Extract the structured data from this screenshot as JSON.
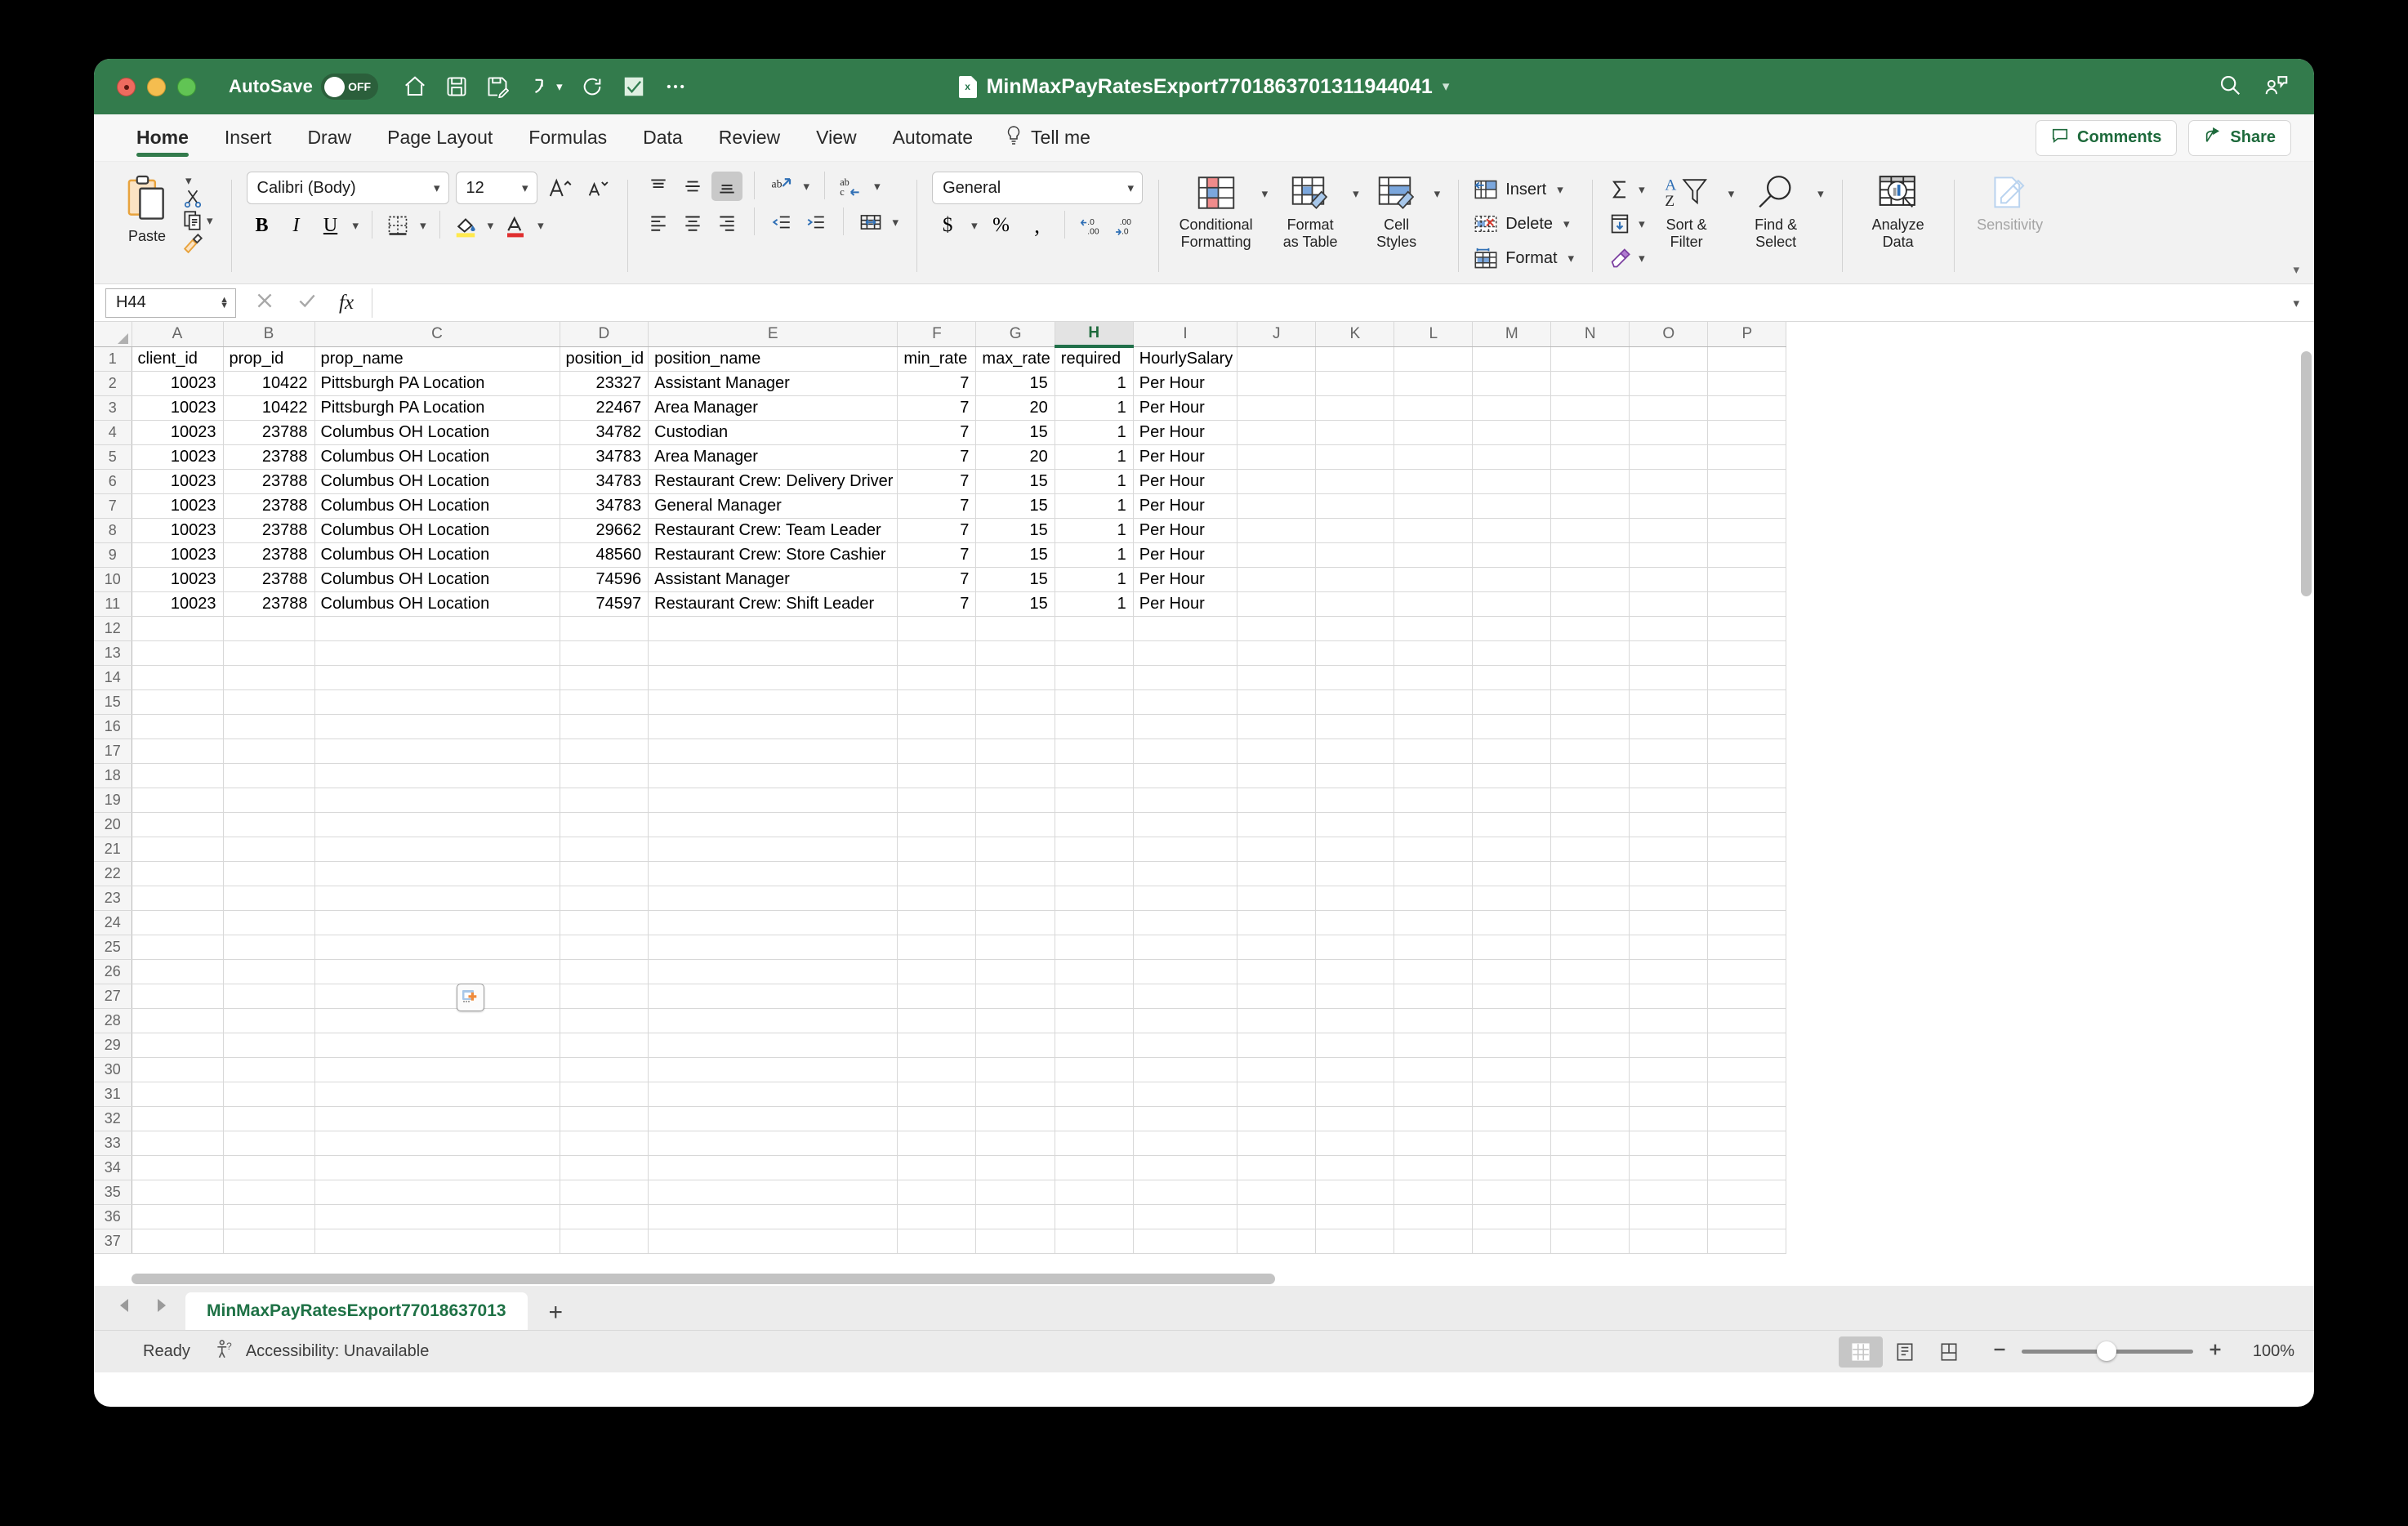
{
  "titlebar": {
    "autosave_label": "AutoSave",
    "autosave_state": "OFF",
    "document_title": "MinMaxPayRatesExport7701863701311944041",
    "xl_badge": "x",
    "accent_green": "#337b4c"
  },
  "tabs": {
    "items": [
      {
        "label": "Home",
        "active": true
      },
      {
        "label": "Insert",
        "active": false
      },
      {
        "label": "Draw",
        "active": false
      },
      {
        "label": "Page Layout",
        "active": false
      },
      {
        "label": "Formulas",
        "active": false
      },
      {
        "label": "Data",
        "active": false
      },
      {
        "label": "Review",
        "active": false
      },
      {
        "label": "View",
        "active": false
      },
      {
        "label": "Automate",
        "active": false
      }
    ],
    "tell_me": "Tell me",
    "comments": "Comments",
    "share": "Share"
  },
  "ribbon": {
    "paste_label": "Paste",
    "font_name": "Calibri (Body)",
    "font_size": "12",
    "number_format": "General",
    "conditional_formatting": "Conditional\nFormatting",
    "conditional_formatting_l1": "Conditional",
    "conditional_formatting_l2": "Formatting",
    "format_as_table_l1": "Format",
    "format_as_table_l2": "as Table",
    "cell_styles_l1": "Cell",
    "cell_styles_l2": "Styles",
    "insert_label": "Insert",
    "delete_label": "Delete",
    "format_label": "Format",
    "sort_filter_l1": "Sort &",
    "sort_filter_l2": "Filter",
    "find_select_l1": "Find &",
    "find_select_l2": "Select",
    "analyze_data_l1": "Analyze",
    "analyze_data_l2": "Data",
    "sensitivity_label": "Sensitivity"
  },
  "formula_bar": {
    "name_box": "H44",
    "formula_value": ""
  },
  "grid": {
    "columns": [
      "A",
      "B",
      "C",
      "D",
      "E",
      "F",
      "G",
      "H",
      "I",
      "J",
      "K",
      "L",
      "M",
      "N",
      "O",
      "P"
    ],
    "selected_column": "H",
    "widths": [
      112,
      112,
      300,
      96,
      294,
      96,
      96,
      96,
      110,
      96,
      96,
      96,
      96,
      96,
      96,
      96
    ],
    "header_row": [
      "client_id",
      "prop_id",
      "prop_name",
      "position_id",
      "position_name",
      "min_rate",
      "max_rate",
      "required",
      "HourlySalary"
    ],
    "rows": [
      {
        "n": 2,
        "cells": [
          "10023",
          "10422",
          "Pittsburgh PA Location",
          "23327",
          "Assistant Manager",
          "7",
          "15",
          "1",
          "Per Hour"
        ]
      },
      {
        "n": 3,
        "cells": [
          "10023",
          "10422",
          "Pittsburgh PA Location",
          "22467",
          "Area Manager",
          "7",
          "20",
          "1",
          "Per Hour"
        ]
      },
      {
        "n": 4,
        "cells": [
          "10023",
          "23788",
          "Columbus OH Location",
          "34782",
          "Custodian",
          "7",
          "15",
          "1",
          "Per Hour"
        ]
      },
      {
        "n": 5,
        "cells": [
          "10023",
          "23788",
          "Columbus OH Location",
          "34783",
          "Area Manager",
          "7",
          "20",
          "1",
          "Per Hour"
        ]
      },
      {
        "n": 6,
        "cells": [
          "10023",
          "23788",
          "Columbus OH Location",
          "34783",
          "Restaurant Crew: Delivery Driver",
          "7",
          "15",
          "1",
          "Per Hour"
        ]
      },
      {
        "n": 7,
        "cells": [
          "10023",
          "23788",
          "Columbus OH Location",
          "34783",
          "General Manager",
          "7",
          "15",
          "1",
          "Per Hour"
        ]
      },
      {
        "n": 8,
        "cells": [
          "10023",
          "23788",
          "Columbus OH Location",
          "29662",
          "Restaurant Crew: Team Leader",
          "7",
          "15",
          "1",
          "Per Hour"
        ]
      },
      {
        "n": 9,
        "cells": [
          "10023",
          "23788",
          "Columbus OH Location",
          "48560",
          "Restaurant Crew: Store Cashier",
          "7",
          "15",
          "1",
          "Per Hour"
        ]
      },
      {
        "n": 10,
        "cells": [
          "10023",
          "23788",
          "Columbus OH Location",
          "74596",
          "Assistant Manager",
          "7",
          "15",
          "1",
          "Per Hour"
        ]
      },
      {
        "n": 11,
        "cells": [
          "10023",
          "23788",
          "Columbus OH Location",
          "74597",
          "Restaurant Crew: Shift Leader",
          "7",
          "15",
          "1",
          "Per Hour"
        ]
      }
    ],
    "empty_rows_from": 12,
    "empty_rows_to": 37,
    "numeric_columns": [
      0,
      1,
      3,
      5,
      6,
      7
    ]
  },
  "sheet_bar": {
    "sheet_name": "MinMaxPayRatesExport77018637013",
    "add_label": "+"
  },
  "status_bar": {
    "state": "Ready",
    "accessibility": "Accessibility: Unavailable",
    "zoom": "100%"
  }
}
